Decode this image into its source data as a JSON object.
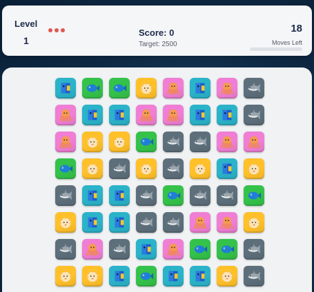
{
  "header": {
    "level_label": "Level",
    "level_value": "1",
    "score_label": "Score: 0",
    "target_label": "Target: 2500",
    "moves_value": "18",
    "moves_label": "Moves Left",
    "moves_progress": 0
  },
  "tile_types": {
    "angelfish": {
      "icon": "angelfish-icon",
      "bg": "#2bb3c9"
    },
    "fish": {
      "icon": "green-fish-icon",
      "bg": "#34c24a"
    },
    "puffer": {
      "icon": "pufferfish-icon",
      "bg": "#ffc02a"
    },
    "octopus": {
      "icon": "octopus-icon",
      "bg": "#f07ed4"
    },
    "shark": {
      "icon": "shark-icon",
      "bg": "#5d6f7b"
    },
    "bluefish": {
      "icon": "blue-fish-icon",
      "bg": "#138fa9"
    }
  },
  "grid": [
    [
      "angelfish",
      "fish",
      "fish",
      "puffer",
      "octopus",
      "angelfish",
      "octopus",
      "shark"
    ],
    [
      "octopus",
      "angelfish",
      "angelfish",
      "octopus",
      "octopus",
      "angelfish",
      "angelfish",
      "shark"
    ],
    [
      "octopus",
      "puffer",
      "puffer",
      "fish",
      "shark",
      "shark",
      "octopus",
      "octopus"
    ],
    [
      "fish",
      "puffer",
      "shark",
      "puffer",
      "shark",
      "puffer",
      "angelfish",
      "puffer"
    ],
    [
      "shark",
      "angelfish",
      "angelfish",
      "shark",
      "fish",
      "shark",
      "shark",
      "fish"
    ],
    [
      "puffer",
      "angelfish",
      "angelfish",
      "shark",
      "shark",
      "octopus",
      "octopus",
      "puffer"
    ],
    [
      "shark",
      "octopus",
      "shark",
      "angelfish",
      "octopus",
      "fish",
      "fish",
      "shark"
    ],
    [
      "puffer",
      "puffer",
      "angelfish",
      "fish",
      "angelfish",
      "angelfish",
      "puffer",
      "shark"
    ]
  ]
}
